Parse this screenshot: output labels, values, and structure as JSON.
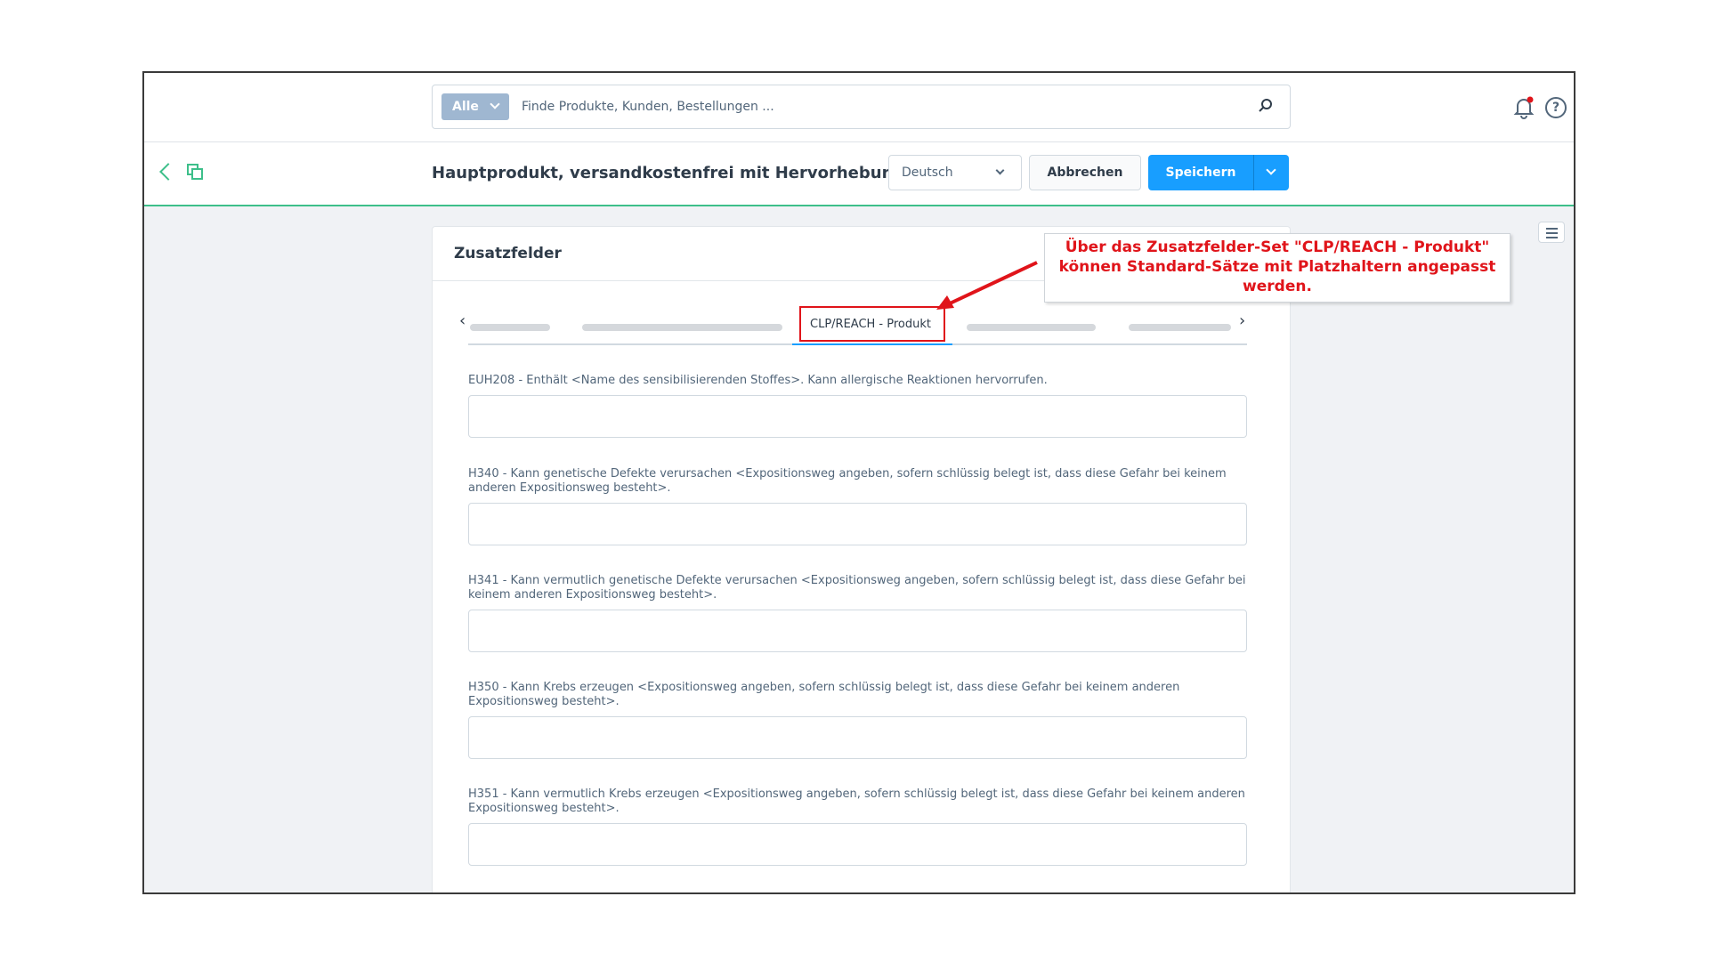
{
  "topbar": {
    "scope_label": "Alle",
    "search_placeholder": "Finde Produkte, Kunden, Bestellungen ..."
  },
  "actionbar": {
    "title": "Hauptprodukt, versandkostenfrei mit Hervorhebung",
    "language": "Deutsch",
    "cancel_label": "Abbrechen",
    "save_label": "Speichern"
  },
  "card": {
    "title": "Zusatzfelder",
    "active_tab": "CLP/REACH - Produkt",
    "fields": [
      {
        "label": "EUH208 - Enthält <Name des sensibilisierenden Stoffes>. Kann allergische Reaktionen hervorrufen.",
        "value": ""
      },
      {
        "label": "H340 - Kann genetische Defekte verursachen <Expositionsweg angeben, sofern schlüssig belegt ist, dass diese Gefahr bei keinem anderen Expositionsweg besteht>.",
        "value": ""
      },
      {
        "label": "H341 - Kann vermutlich genetische Defekte verursachen <Expositionsweg angeben, sofern schlüssig belegt ist, dass diese Gefahr bei keinem anderen Expositionsweg besteht>.",
        "value": ""
      },
      {
        "label": "H350 - Kann Krebs erzeugen <Expositionsweg angeben, sofern schlüssig belegt ist, dass diese Gefahr bei keinem anderen Expositionsweg besteht>.",
        "value": ""
      },
      {
        "label": "H351 - Kann vermutlich Krebs erzeugen <Expositionsweg angeben, sofern schlüssig belegt ist, dass diese Gefahr bei keinem anderen Expositionsweg besteht>.",
        "value": ""
      }
    ]
  },
  "annotation": {
    "line1": "Über das Zusatzfelder-Set \"CLP/REACH - Produkt\"",
    "line2": "können Standard-Sätze mit Platzhaltern angepasst",
    "line3": "werden."
  },
  "colors": {
    "accent": "#189eff",
    "success_line": "#3dbf8a",
    "annotation_red": "#e0141a"
  },
  "icons": [
    "search-icon",
    "bell-icon",
    "help-icon",
    "back-icon",
    "copy-icon",
    "menu-icon"
  ]
}
